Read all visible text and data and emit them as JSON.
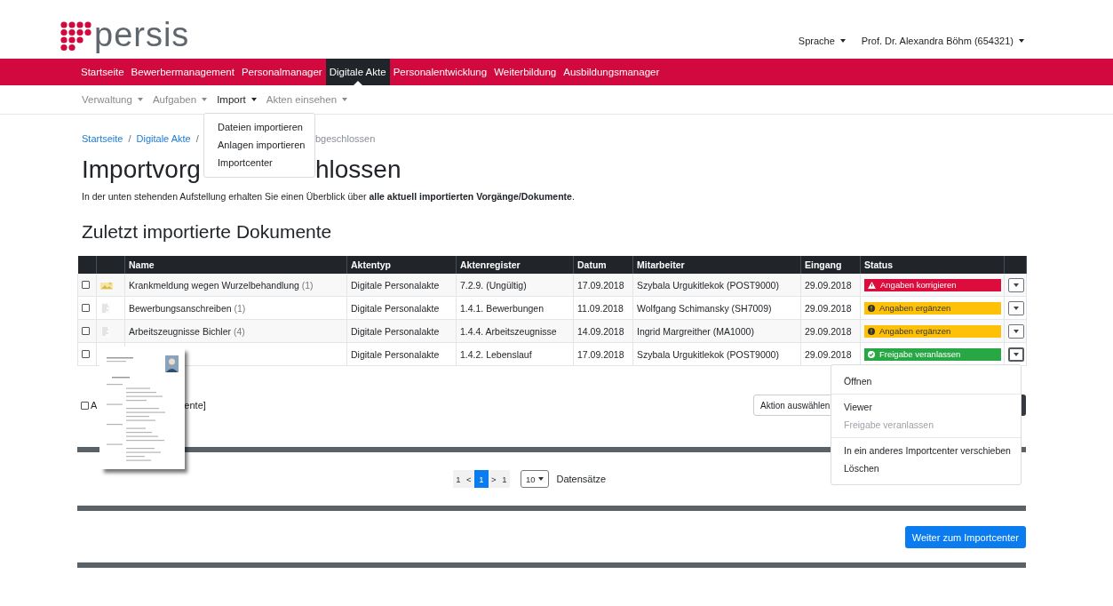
{
  "header": {
    "logo_text": "persis",
    "menus": [
      {
        "label": "Sprache"
      },
      {
        "label": "Prof. Dr. Alexandra Böhm (654321)"
      }
    ]
  },
  "main_nav": [
    {
      "label": "Startseite",
      "selected": false
    },
    {
      "label": "Bewerbermanagement",
      "selected": false
    },
    {
      "label": "Personalmanager",
      "selected": false
    },
    {
      "label": "Digitale Akte",
      "selected": true
    },
    {
      "label": "Personalentwicklung",
      "selected": false
    },
    {
      "label": "Weiterbildung",
      "selected": false
    },
    {
      "label": "Ausbildungsmanager",
      "selected": false
    }
  ],
  "sub_nav": [
    {
      "label": "Verwaltung",
      "selected": false
    },
    {
      "label": "Aufgaben",
      "selected": false
    },
    {
      "label": "Import",
      "selected": true
    },
    {
      "label": "Akten einsehen",
      "selected": false
    }
  ],
  "import_menu": [
    "Dateien importieren",
    "Anlagen importieren",
    "Importcenter"
  ],
  "breadcrumb": {
    "links": [
      {
        "label": "Startseite",
        "separator": "/"
      },
      {
        "label": "Digitale Akte",
        "separator": "/"
      }
    ],
    "current_fragment": "bgeschlossen"
  },
  "title_fragments": [
    "Importvorg",
    "hlossen"
  ],
  "description": "In der unten stehenden Aufstellung erhalten Sie einen Überblick über **alle aktuell importierten Vorgänge/Dokumente**.",
  "section_title": "Zuletzt importierte Dokumente",
  "table": {
    "columns": [
      "Name",
      "Aktentyp",
      "Aktenregister",
      "Datum",
      "Mitarbeiter",
      "Eingang",
      "Status"
    ],
    "rows": [
      {
        "checked": false,
        "kind": "image",
        "name": "Krankmeldung wegen Wurzelbehandlung",
        "count": "(1)",
        "aktentyp": "Digitale Personalakte",
        "register": "7.2.9. (Ungültig)",
        "datum": "17.09.2018",
        "mitarbeiter": "Szybala Urgukitlekok (POST9000)",
        "eingang": "29.09.2018",
        "status": {
          "kind": "danger",
          "label": "Angaben korrigieren"
        },
        "menu_open": false
      },
      {
        "checked": false,
        "kind": "document",
        "name": "Bewerbungsanschreiben",
        "count": "(1)",
        "aktentyp": "Digitale Personalakte",
        "register": "1.4.1. Bewerbungen",
        "datum": "11.09.2018",
        "mitarbeiter": "Wolfgang Schimansky (SH7009)",
        "eingang": "29.09.2018",
        "status": {
          "kind": "warning",
          "label": "Angaben ergänzen"
        },
        "menu_open": false
      },
      {
        "checked": false,
        "kind": "document",
        "name": "Arbeitszeugnisse Bichler",
        "count": "(4)",
        "aktentyp": "Digitale Personalakte",
        "register": "1.4.4. Arbeitszeugnisse",
        "datum": "14.09.2018",
        "mitarbeiter": "Ingrid Margreither (MA1000)",
        "eingang": "29.09.2018",
        "status": {
          "kind": "warning",
          "label": "Angaben ergänzen"
        },
        "menu_open": false
      },
      {
        "checked": false,
        "aktentyp": "Digitale Personalakte",
        "register": "1.4.2. Lebenslauf",
        "datum": "17.09.2018",
        "mitarbeiter": "Szybala Urgukitlekok (POST9000)",
        "eingang": "29.09.2018",
        "status": {
          "kind": "success",
          "label": "Freigabe veranlassen"
        },
        "menu_open": true
      }
    ]
  },
  "row_menu": {
    "groups": [
      [
        {
          "label": "Öffnen",
          "disabled": false
        }
      ],
      [
        {
          "label": "Viewer",
          "disabled": false
        },
        {
          "label": "Freigabe veranlassen",
          "disabled": true
        }
      ],
      [
        {
          "label": "In ein anderes Importcenter verschieben",
          "disabled": false
        },
        {
          "label": "Löschen",
          "disabled": false
        }
      ]
    ]
  },
  "bulk": {
    "checked": false,
    "label_fragments": [
      "A",
      "ente]"
    ],
    "action_select": "Aktion auswählen"
  },
  "pagination": {
    "items": [
      {
        "label": "1",
        "selected": false
      },
      {
        "label": "<",
        "selected": false
      },
      {
        "label": "1",
        "selected": true
      },
      {
        "label": ">",
        "selected": false
      },
      {
        "label": "1",
        "selected": false
      }
    ],
    "page_size": "10",
    "page_size_label": "Datensätze"
  },
  "continue_button": "Weiter zum Importcenter"
}
